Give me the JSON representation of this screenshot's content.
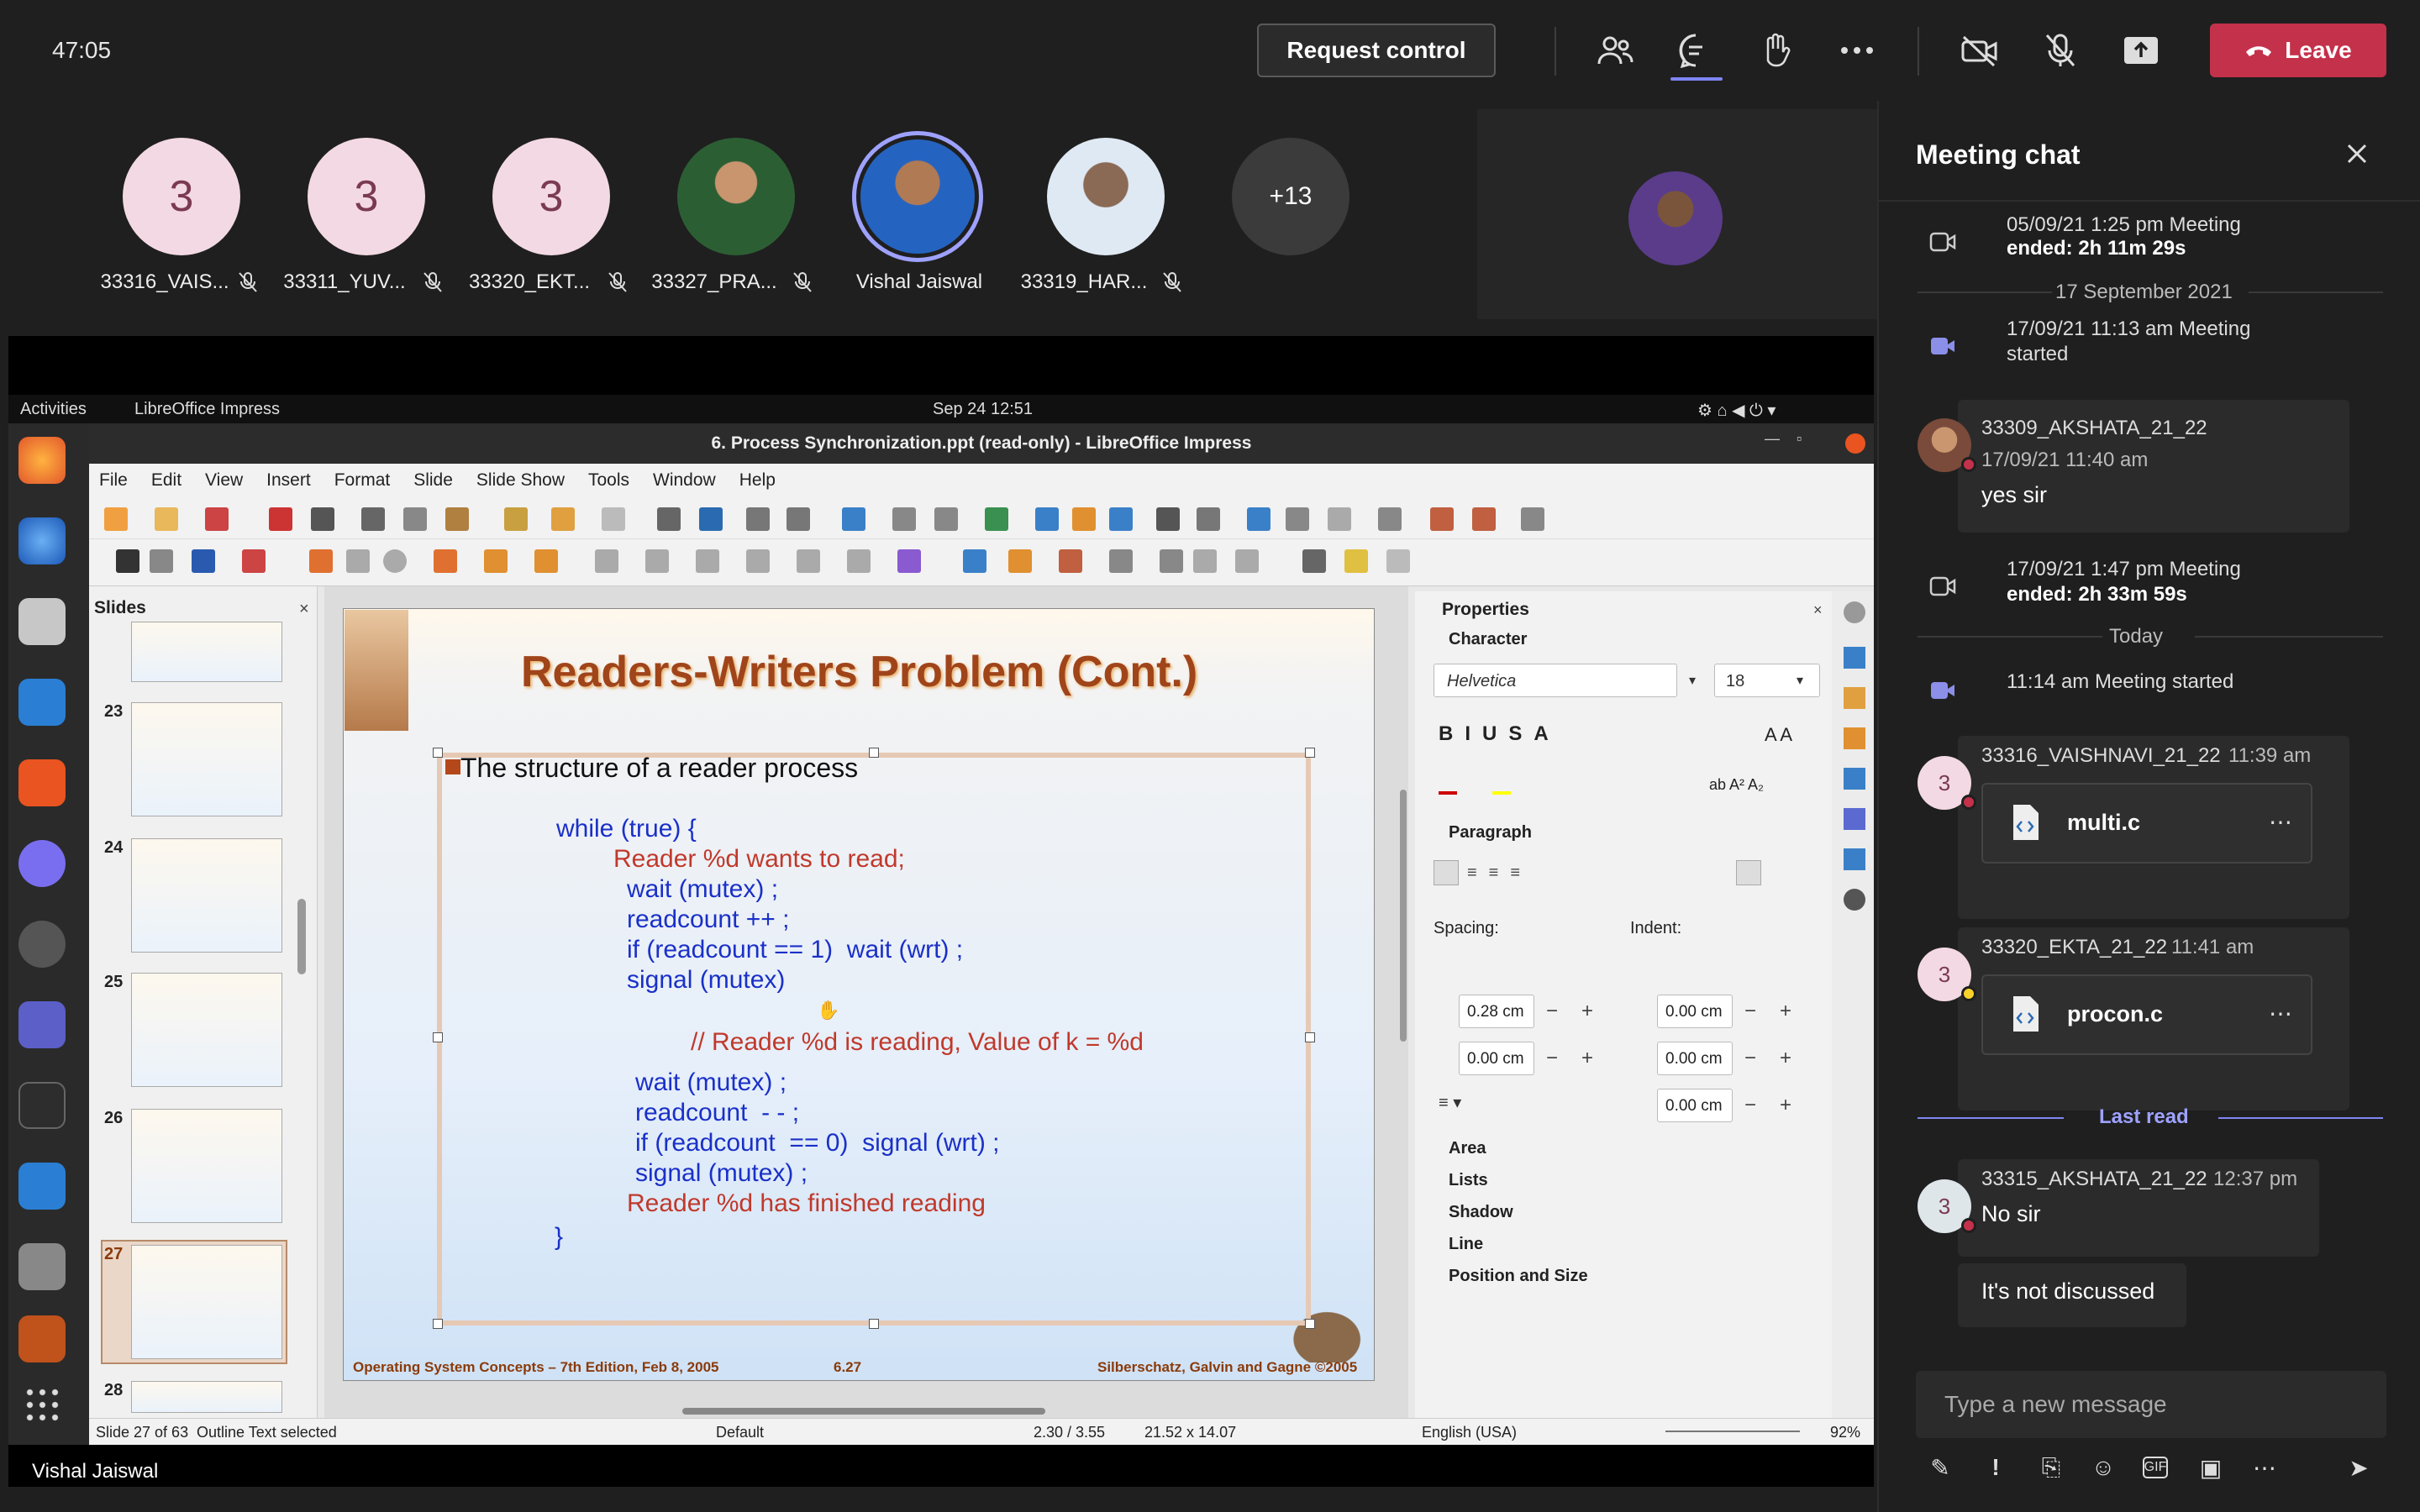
{
  "topbar": {
    "timer": "47:05",
    "request_control": "Request control",
    "leave": "Leave"
  },
  "participants": [
    {
      "initial": "3",
      "name": "33316_VAIS...",
      "type": "initial"
    },
    {
      "initial": "3",
      "name": "33311_YUV...",
      "type": "initial"
    },
    {
      "initial": "3",
      "name": "33320_EKT...",
      "type": "initial"
    },
    {
      "initial": "",
      "name": "33327_PRA...",
      "type": "photo"
    },
    {
      "initial": "",
      "name": "Vishal Jaiswal",
      "type": "photo"
    },
    {
      "initial": "",
      "name": "33319_HAR...",
      "type": "photo"
    },
    {
      "initial": "+13",
      "name": "",
      "type": "more"
    }
  ],
  "shared": {
    "sharer_name": "Vishal Jaiswal",
    "ubuntu": {
      "activities": "Activities",
      "app": "LibreOffice Impress",
      "datetime": "Sep 24  12:51"
    },
    "lo_title": "6. Process Synchronization.ppt (read-only) - LibreOffice Impress",
    "menu": [
      "File",
      "Edit",
      "View",
      "Insert",
      "Format",
      "Slide",
      "Slide Show",
      "Tools",
      "Window",
      "Help"
    ],
    "slides_pane_title": "Slides",
    "slide_numbers": [
      "23",
      "24",
      "25",
      "26",
      "27",
      "28"
    ],
    "slide": {
      "title": "Readers-Writers Problem (Cont.)",
      "bullet": "The structure of a reader process",
      "lines": [
        {
          "text": "while (true) {",
          "color": "blue",
          "indent": 0
        },
        {
          "text": "Reader %d wants to read;",
          "color": "red",
          "indent": 1
        },
        {
          "text": "wait (mutex) ;",
          "color": "blue",
          "indent": 2
        },
        {
          "text": "readcount ++ ;",
          "color": "blue",
          "indent": 2
        },
        {
          "text": "if (readcount == 1)  wait (wrt) ;",
          "color": "blue",
          "indent": 2
        },
        {
          "text": "signal (mutex)",
          "color": "blue",
          "indent": 2
        },
        {
          "text": "// Reader %d is reading, Value of k = %d",
          "color": "red",
          "indent": 3
        },
        {
          "text": "wait (mutex) ;",
          "color": "blue",
          "indent": 4
        },
        {
          "text": "readcount  - - ;",
          "color": "blue",
          "indent": 4
        },
        {
          "text": "if (readcount  == 0)  signal (wrt) ;",
          "color": "blue",
          "indent": 4
        },
        {
          "text": "signal (mutex) ;",
          "color": "blue",
          "indent": 4
        },
        {
          "text": "Reader %d has finished reading",
          "color": "red",
          "indent": 2
        },
        {
          "text": "}",
          "color": "blue",
          "indent": 0
        }
      ],
      "footer_left": "Operating System Concepts – 7th Edition, Feb 8, 2005",
      "footer_mid": "6.27",
      "footer_right": "Silberschatz, Galvin and Gagne ©2005"
    },
    "properties": {
      "title": "Properties",
      "character": "Character",
      "font": "Helvetica",
      "size": "18",
      "paragraph": "Paragraph",
      "spacing": "Spacing:",
      "indent": "Indent:",
      "sp_above": "0.28 cm",
      "sp_below": "0.00 cm",
      "in_before": "0.00 cm",
      "in_after": "0.00 cm",
      "in_first": "0.00 cm",
      "sections": [
        "Area",
        "Lists",
        "Shadow",
        "Line",
        "Position and Size"
      ]
    },
    "status": {
      "slide": "Slide 27 of 63",
      "selection": "Outline Text selected",
      "layout": "Default",
      "pos": "2.30 / 3.55",
      "size": "21.52 x 14.07",
      "lang": "English (USA)",
      "zoom": "92%"
    }
  },
  "chat": {
    "title": "Meeting chat",
    "events": [
      {
        "text": "05/09/21 1:25 pm   Meeting",
        "strong": "ended: 2h 11m 29s"
      },
      {
        "date": "17 September 2021"
      },
      {
        "text": "17/09/21 11:13 am   Meeting",
        "strong": "started"
      }
    ],
    "msg1": {
      "sender": "33309_AKSHATA_21_22",
      "time": "17/09/21 11:40 am",
      "text": "yes sir"
    },
    "event2": {
      "text": "17/09/21 1:47 pm   Meeting",
      "strong": "ended: 2h 33m 59s"
    },
    "today": "Today",
    "event3": {
      "text": "11:14 am   Meeting started"
    },
    "msg2": {
      "initial": "3",
      "sender": "33316_VAISHNAVI_21_22",
      "time": "11:39 am",
      "file": "multi.c"
    },
    "msg3": {
      "initial": "3",
      "sender": "33320_EKTA_21_22",
      "time": "11:41 am",
      "file": "procon.c"
    },
    "last_read": "Last read",
    "msg4": {
      "initial": "3",
      "sender": "33315_AKSHATA_21_22",
      "time": "12:37 pm",
      "text": "No sir",
      "text2": "It's not discussed"
    },
    "compose_placeholder": "Type a new message"
  },
  "colors": {
    "accent": "#7f85f5",
    "leave": "#c4314b",
    "title_brown": "#a0441a",
    "code_blue": "#1a30c8",
    "code_red": "#c0392b"
  }
}
